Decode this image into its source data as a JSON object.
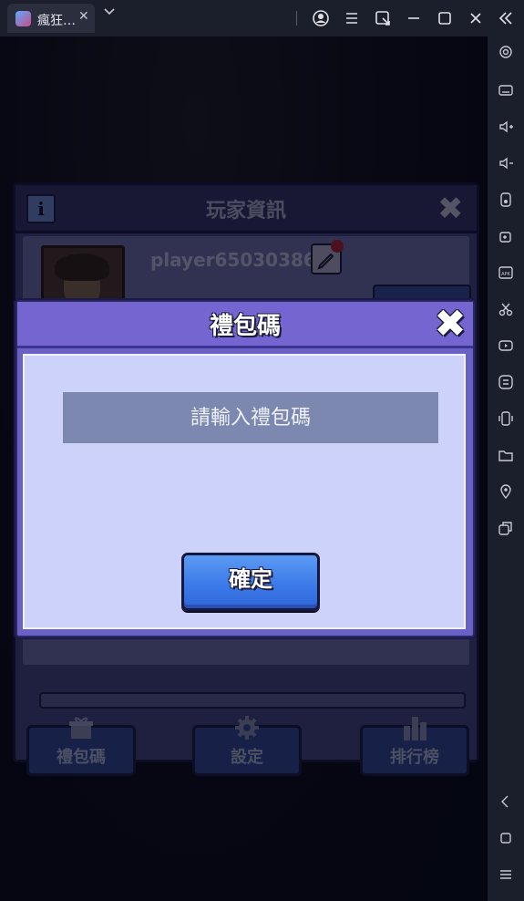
{
  "window": {
    "tab_title": "瘋狂…",
    "tab_close": "✕"
  },
  "panel": {
    "title": "玩家資訊",
    "info_label": "i",
    "close_label": "✖",
    "player_name": "player65030386",
    "buttons": [
      {
        "label": "禮包碼",
        "icon": "gift-icon"
      },
      {
        "label": "設定",
        "icon": "gear-icon"
      },
      {
        "label": "排行榜",
        "icon": "leaderboard-icon"
      }
    ]
  },
  "modal": {
    "title": "禮包碼",
    "close_label": "✖",
    "input_placeholder": "請輸入禮包碼",
    "input_value": "",
    "confirm_label": "確定"
  },
  "sidebar_icons": [
    "settings-icon",
    "keyboard-icon",
    "volume-up-icon",
    "volume-down-icon",
    "lock-rotate-icon",
    "add-app-icon",
    "apk-icon",
    "scissors-icon",
    "record-icon",
    "sync-icon",
    "shake-icon",
    "folder-icon",
    "location-icon",
    "multi-instance-icon",
    "back-icon",
    "home-icon",
    "menu-icon"
  ],
  "colors": {
    "modal_accent": "#7465d0",
    "confirm_button": "#3a78e8",
    "input_bg": "#7c88b0",
    "modal_body": "#cdd2fa"
  }
}
